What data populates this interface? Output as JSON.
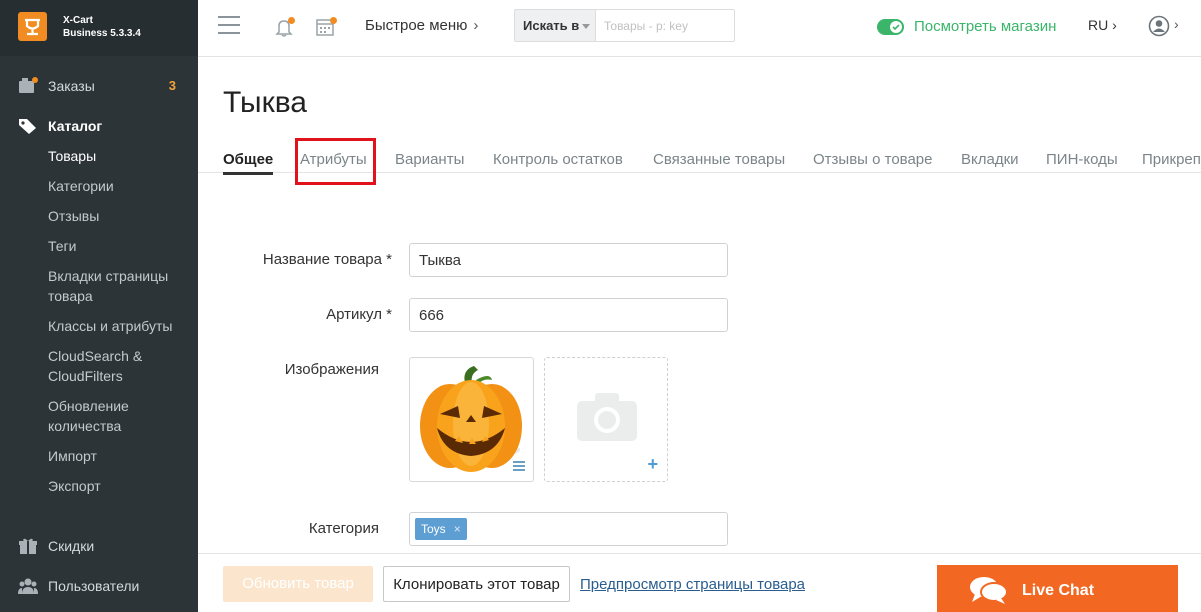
{
  "brand": {
    "name": "X-Cart",
    "version": "Business 5.3.3.4"
  },
  "sidebar": {
    "orders": {
      "label": "Заказы",
      "count": "3"
    },
    "catalog": {
      "label": "Каталог"
    },
    "catalog_items": [
      "Товары",
      "Категории",
      "Отзывы",
      "Теги",
      "Вкладки страницы товара",
      "Классы и атрибуты",
      "CloudSearch & CloudFilters",
      "Обновление количества",
      "Импорт",
      "Экспорт"
    ],
    "discounts": {
      "label": "Скидки"
    },
    "users": {
      "label": "Пользователи"
    }
  },
  "topbar": {
    "quick_menu": "Быстрое меню",
    "search_in": "Искать в",
    "search_placeholder": "Товары - p: key",
    "view_store": "Посмотреть магазин",
    "language": "RU"
  },
  "page": {
    "title": "Тыква",
    "tabs": [
      "Общее",
      "Атрибуты",
      "Варианты",
      "Контроль остатков",
      "Связанные товары",
      "Отзывы о товаре",
      "Вкладки",
      "ПИН-коды",
      "Прикреп"
    ],
    "active_tab": "Общее"
  },
  "form": {
    "name_label": "Название товара *",
    "name_value": "Тыква",
    "sku_label": "Артикул *",
    "sku_value": "666",
    "images_label": "Изображения",
    "category_label": "Категория",
    "category_chip": "Toys",
    "chip_remove": "×"
  },
  "footer": {
    "update_button": "Обновить товар",
    "clone_button": "Клонировать этот товар",
    "preview_link": "Предпросмотр страницы товара"
  },
  "livechat": {
    "label": "Live Chat"
  },
  "colors": {
    "sidebar_bg": "#2c3438",
    "accent_orange": "#f08c22",
    "store_green": "#3ab569",
    "highlight_red": "#e0121c",
    "livechat_orange": "#f26722"
  }
}
